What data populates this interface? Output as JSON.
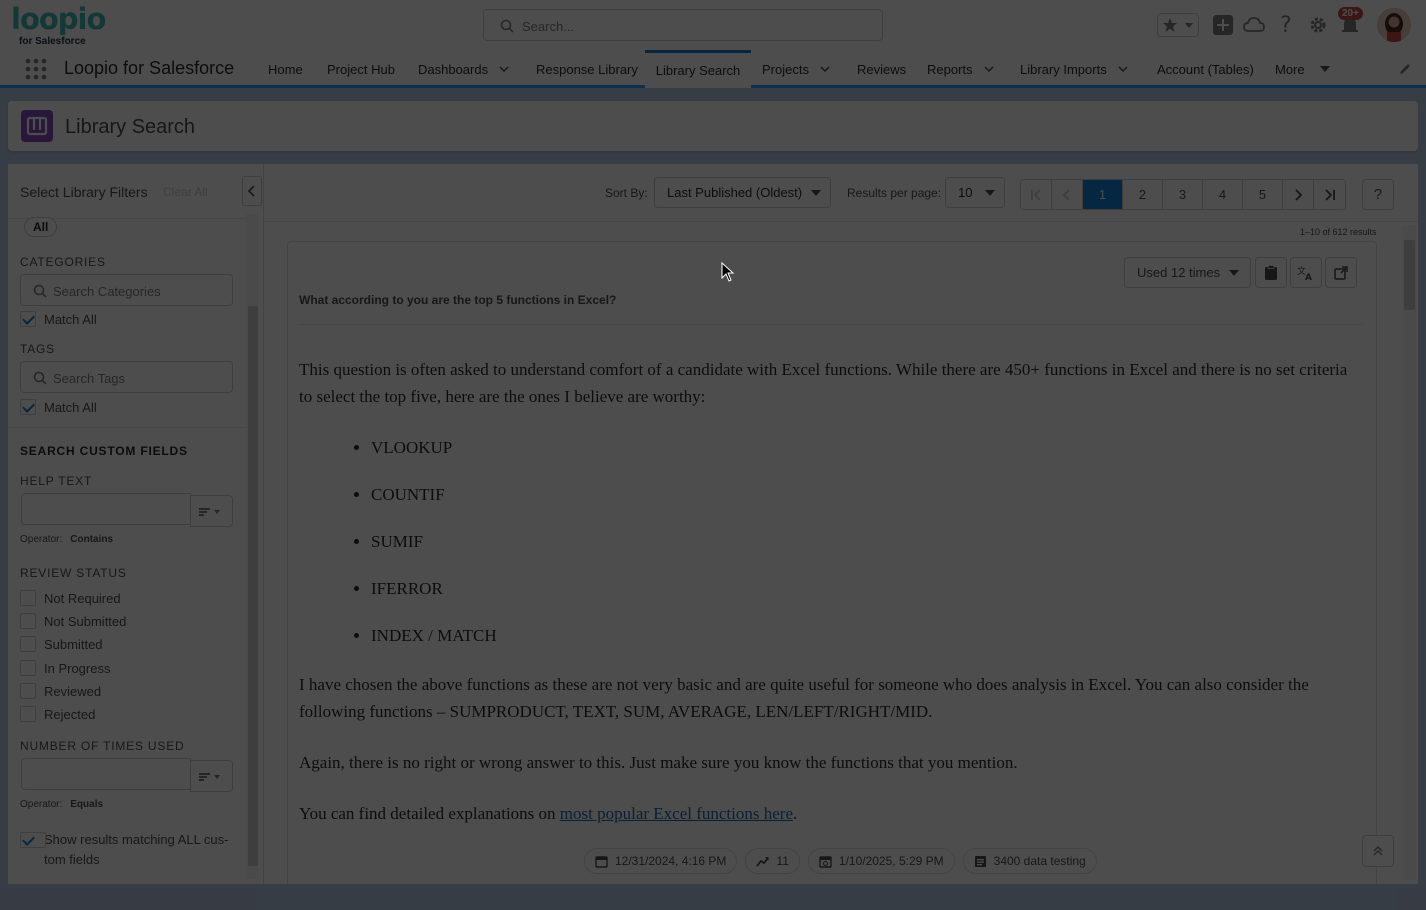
{
  "header": {
    "logo_text": "loopio",
    "logo_sub": "for Salesforce",
    "search_placeholder": "Search...",
    "notification_count": "20+"
  },
  "nav": {
    "app_name": "Loopio for Salesforce",
    "items": [
      {
        "label": "Home"
      },
      {
        "label": "Project Hub"
      },
      {
        "label": "Dashboards"
      },
      {
        "label": "Response Library"
      },
      {
        "label": "Library Search"
      },
      {
        "label": "Projects"
      },
      {
        "label": "Reviews"
      },
      {
        "label": "Reports"
      },
      {
        "label": "Library Imports"
      },
      {
        "label": "Account (Tables)"
      },
      {
        "label": "More"
      }
    ]
  },
  "page": {
    "title": "Library Search"
  },
  "sidebar": {
    "title": "Select Library Filters",
    "clear_all": "Clear All",
    "pill": "All",
    "categories_label": "CATEGORIES",
    "categories_placeholder": "Search Categories",
    "categories_match": "Match All",
    "tags_label": "TAGS",
    "tags_placeholder": "Search Tags",
    "tags_match": "Match All",
    "custom_fields_label": "SEARCH CUSTOM FIELDS",
    "help_text_label": "HELP TEXT",
    "help_operator_label": "Operator:",
    "help_operator_value": "Contains",
    "review_status_label": "REVIEW STATUS",
    "review_statuses": [
      "Not Required",
      "Not Submitted",
      "Submitted",
      "In Progress",
      "Reviewed",
      "Rejected"
    ],
    "times_used_label": "NUMBER OF TIMES USED",
    "times_operator_label": "Operator:",
    "times_operator_value": "Equals",
    "show_all_label": "Show results matching ALL cus-tom fields"
  },
  "toolbar": {
    "sort_label": "Sort By:",
    "sort_value": "Last Published (Oldest)",
    "per_page_label": "Results per page:",
    "per_page_value": "10",
    "pages": [
      "1",
      "2",
      "3",
      "4",
      "5"
    ],
    "current_page": "1",
    "help": "?",
    "results_count": "1–10 of 612 results"
  },
  "result": {
    "used_label": "Used 12 times",
    "question": "What according to you are the top 5 functions in Excel?",
    "para1": "This question is often asked to understand comfort of a candidate with Excel functions. While there are 450+ functions in Excel and there is no set criteria to select the top five, here are the ones I believe are worthy:",
    "list": [
      "VLOOKUP",
      "COUNTIF",
      "SUMIF",
      "IFERROR",
      "INDEX / MATCH"
    ],
    "para2": "I have chosen the above functions as these are not very basic and are quite useful for someone who does analysis in Excel. You can also consider the following functions – SUMPRODUCT, TEXT, SUM, AVERAGE, LEN/LEFT/RIGHT/MID.",
    "para3": "Again, there is no right or wrong answer to this. Just make sure you know the functions that you mention.",
    "para4_prefix": "You can find detailed explanations on ",
    "para4_link": "most popular Excel functions here",
    "para4_suffix": ".",
    "meta_created": "12/31/2024, 4:16 PM",
    "meta_trend": "11",
    "meta_updated": "1/10/2025, 5:29 PM",
    "meta_project": "3400 data testing"
  },
  "colors": {
    "brand": "#0176d3",
    "logo": "#2eb5b0",
    "page_icon": "#7f3fbf",
    "overlay": "#080808"
  }
}
